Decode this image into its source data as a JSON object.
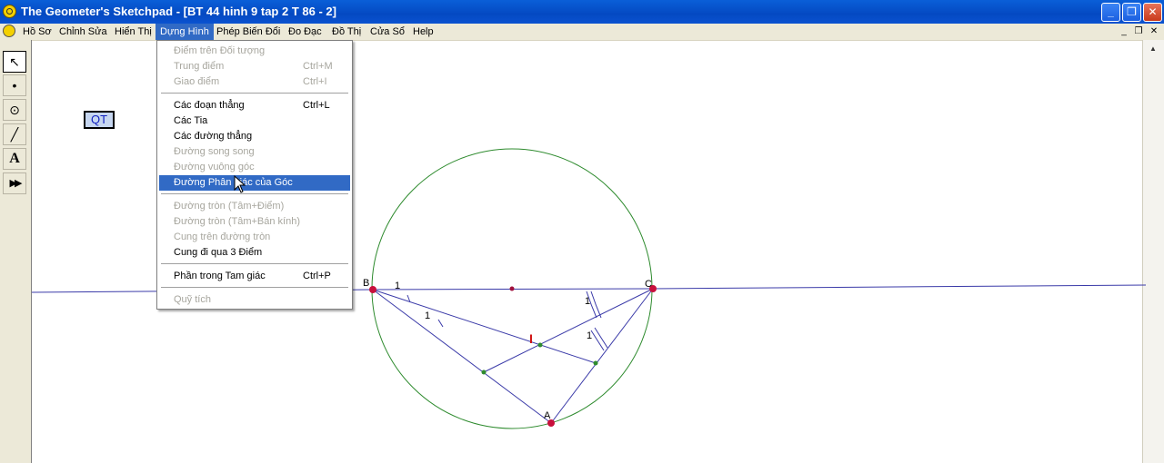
{
  "window": {
    "title": "The Geometer's Sketchpad - [BT 44 hinh 9 tap 2 T 86 - 2]",
    "minimize_glyph": "_",
    "restore_glyph": "❐",
    "close_glyph": "✕"
  },
  "menubar": {
    "items": [
      {
        "label": "Hồ Sơ"
      },
      {
        "label": "Chỉnh Sửa"
      },
      {
        "label": "Hiển Thị"
      },
      {
        "label": "Dựng Hình"
      },
      {
        "label": "Phép Biến Đổi"
      },
      {
        "label": "Đo Đạc"
      },
      {
        "label": "Đồ Thị"
      },
      {
        "label": "Cửa Sổ"
      },
      {
        "label": "Help"
      }
    ],
    "active_index": 3,
    "mdi_minimize": "_",
    "mdi_restore": "❐",
    "mdi_close": "✕"
  },
  "toolbox": {
    "tools": [
      {
        "name": "arrow-select-tool",
        "glyph": "↖"
      },
      {
        "name": "point-tool",
        "glyph": "•"
      },
      {
        "name": "compass-tool",
        "glyph": "⊙"
      },
      {
        "name": "straightedge-tool",
        "glyph": "╱"
      },
      {
        "name": "text-tool",
        "glyph": "A"
      },
      {
        "name": "custom-tool",
        "glyph": "▶▶"
      }
    ]
  },
  "action_button": {
    "label": "QT"
  },
  "dropdown": {
    "items": [
      {
        "label": "Điểm trên Đối tượng",
        "shortcut": "",
        "enabled": false
      },
      {
        "label": "Trung điểm",
        "shortcut": "Ctrl+M",
        "enabled": false
      },
      {
        "label": "Giao điểm",
        "shortcut": "Ctrl+I",
        "enabled": false
      },
      {
        "label": "Các đoạn thẳng",
        "shortcut": "Ctrl+L",
        "enabled": true
      },
      {
        "label": "Các Tia",
        "shortcut": "",
        "enabled": true
      },
      {
        "label": "Các đường thẳng",
        "shortcut": "",
        "enabled": true
      },
      {
        "label": "Đường song song",
        "shortcut": "",
        "enabled": false
      },
      {
        "label": "Đường vuông góc",
        "shortcut": "",
        "enabled": false
      },
      {
        "label": "Đường Phân giác của Góc",
        "shortcut": "",
        "enabled": true,
        "highlighted": true
      },
      {
        "label": "Đường tròn (Tâm+Điểm)",
        "shortcut": "",
        "enabled": false
      },
      {
        "label": "Đường tròn (Tâm+Bán kính)",
        "shortcut": "",
        "enabled": false
      },
      {
        "label": "Cung trên đường tròn",
        "shortcut": "",
        "enabled": false
      },
      {
        "label": "Cung đi qua 3 Điểm",
        "shortcut": "",
        "enabled": true
      },
      {
        "label": "Phần trong Tam giác",
        "shortcut": "Ctrl+P",
        "enabled": true
      },
      {
        "label": "Quỹ tích",
        "shortcut": "",
        "enabled": false
      }
    ]
  },
  "sketch": {
    "labels": {
      "B": "B",
      "C": "C",
      "A": "A",
      "I": "I",
      "angle_mark": "1"
    },
    "colors": {
      "circle": "#2e8b2e",
      "line": "#3a3aa8",
      "point_major": "#c8103c",
      "point_minor": "#2e8b2e",
      "label_i": "#d01010"
    }
  }
}
